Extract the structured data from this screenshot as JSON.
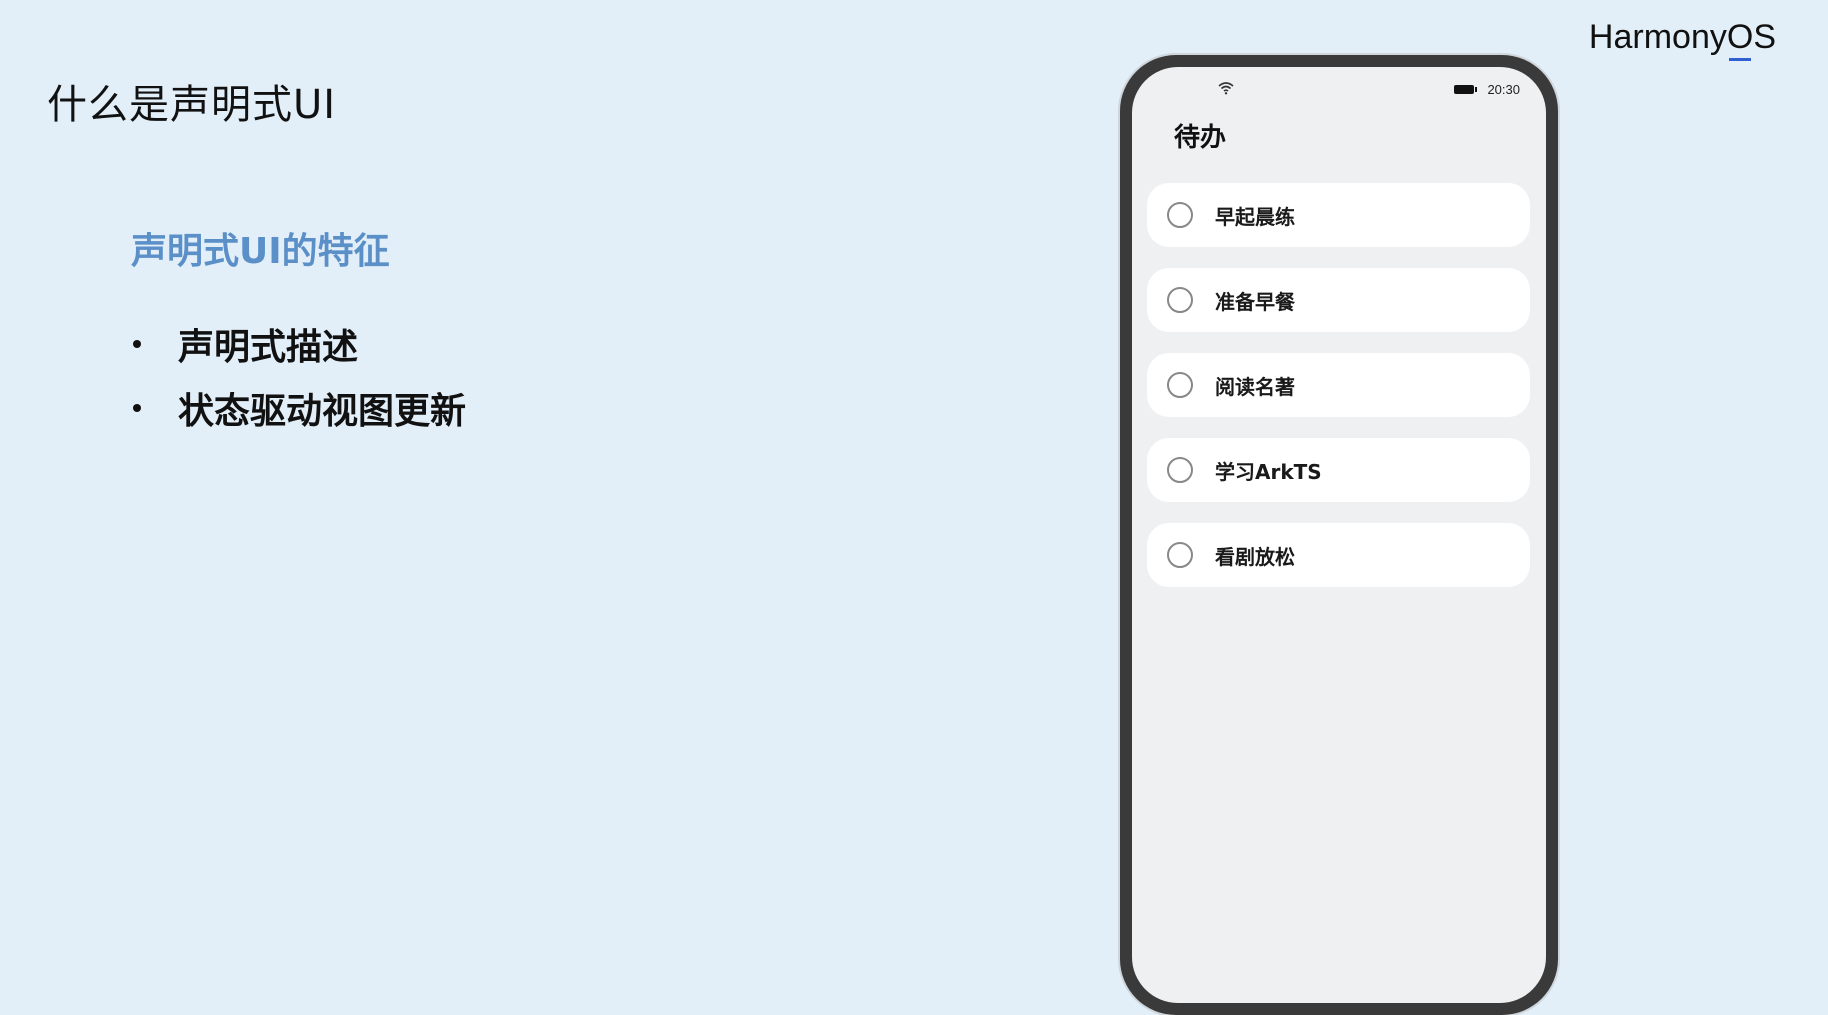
{
  "slide": {
    "title": "什么是声明式UI",
    "brand_prefix": "Harmony",
    "brand_o": "O",
    "brand_suffix": "S",
    "section_heading": "声明式UI的特征",
    "bullets": [
      "声明式描述",
      "状态驱动视图更新"
    ]
  },
  "phone": {
    "status_bar": {
      "wifi_icon": "wifi-icon",
      "battery_icon": "battery-icon",
      "time": "20:30"
    },
    "page_title": "待办",
    "todo_items": [
      {
        "label": "早起晨练",
        "checked": false
      },
      {
        "label": "准备早餐",
        "checked": false
      },
      {
        "label": "阅读名著",
        "checked": false
      },
      {
        "label": "学习ArkTS",
        "checked": false
      },
      {
        "label": "看剧放松",
        "checked": false
      }
    ]
  },
  "colors": {
    "background": "#e2eff9",
    "section_heading": "#5a8fc8",
    "brand_accent": "#2f5fd0"
  }
}
